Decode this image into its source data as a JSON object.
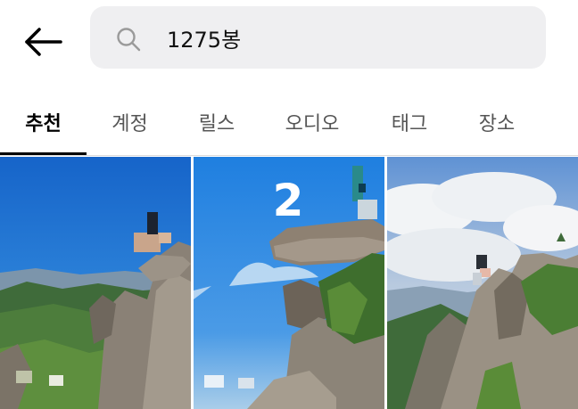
{
  "search": {
    "query": "1275봉"
  },
  "tabs": [
    {
      "label": "추천",
      "active": true
    },
    {
      "label": "계정",
      "active": false
    },
    {
      "label": "릴스",
      "active": false
    },
    {
      "label": "오디오",
      "active": false
    },
    {
      "label": "태그",
      "active": false
    },
    {
      "label": "장소",
      "active": false
    }
  ],
  "results": [
    {
      "badge": ""
    },
    {
      "badge": "2"
    },
    {
      "badge": ""
    }
  ],
  "colors": {
    "active_tab": "#000000",
    "inactive_tab": "#555555",
    "search_bg": "#efeff1",
    "sky": "#1a6fd6"
  },
  "icons": {
    "back": "arrow-left-icon",
    "search": "magnifier-icon"
  }
}
